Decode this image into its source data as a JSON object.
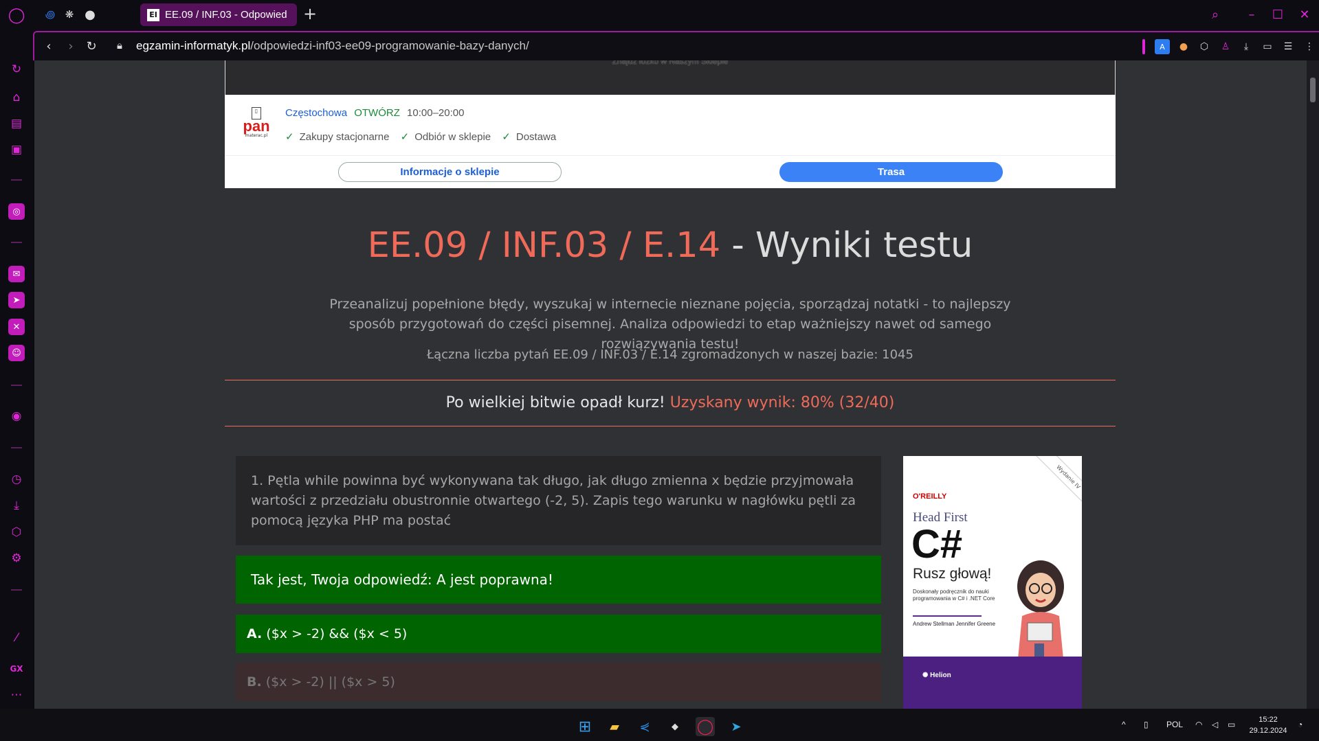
{
  "browser": {
    "tab": {
      "favicon": "EI",
      "title": "EE.09 / INF.03 - Odpowied"
    },
    "url": {
      "domain": "egzamin-informatyk.pl",
      "path": "/odpowiedzi-inf03-ee09-programowanie-bazy-danych/"
    },
    "accent_color": "#e026d8",
    "sidebar_bottom_label": "GX",
    "tray": {
      "lang": "POL",
      "time": "15:22",
      "date": "29.12.2024"
    }
  },
  "ad": {
    "top_text": "Znajdź łóżko w Naszym Sklepie",
    "logo": {
      "brand": "pan",
      "sub": "materac.pl"
    },
    "city": "Częstochowa",
    "status": "OTWÓRZ",
    "hours": "10:00–20:00",
    "features": [
      "Zakupy stacjonarne",
      "Odbiór w sklepie",
      "Dostawa"
    ],
    "info_button": "Informacje o sklepie",
    "route_button": "Trasa"
  },
  "page": {
    "title_code": "EE.09 / INF.03 / E.14",
    "title_rest": " - Wyniki testu",
    "lead": "Przeanalizuj popełnione błędy, wyszukaj w internecie nieznane pojęcia, sporządzaj notatki - to najlepszy sposób przygotowań do części pisemnej. Analiza odpowiedzi to etap ważniejszy nawet od samego rozwiązywania testu!",
    "count": "Łączna liczba pytań EE.09 / INF.03 / E.14 zgromadzonych w naszej bazie: 1045",
    "result_prefix": "Po wielkiej bitwie opadł kurz! ",
    "result_score": "Uzyskany wynik: 80% (32/40)",
    "question": "1. Pętla while powinna być wykonywana tak długo, jak długo zmienna x będzie przyjmowała wartości z przedziału obustronnie otwartego (-2, 5). Zapis tego warunku w nagłówku pętli za pomocą języka PHP ma postać",
    "verdict": "Tak jest, Twoja odpowiedź: A jest poprawna!",
    "answers": [
      {
        "letter": "A.",
        "text": "($x > -2) && ($x < 5)"
      },
      {
        "letter": "B.",
        "text": "($x > -2) || ($x > 5)"
      }
    ]
  },
  "book": {
    "edition": "Wydanie IV",
    "publisher": "O'REILLY",
    "series": "Head First",
    "title": "C#",
    "subtitle": "Rusz głową!",
    "desc": "Doskonały podręcznik do nauki programowania w C# i .NET Core",
    "authors": "Andrew Stellman Jennifer Greene",
    "imprint": "Helion"
  }
}
